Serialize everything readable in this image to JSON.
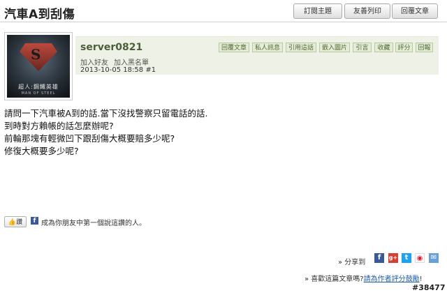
{
  "thread": {
    "title": "汽車A到刮傷"
  },
  "toolbar": {
    "subscribe": "訂閱主題",
    "print": "友善列印",
    "reply": "回覆文章"
  },
  "avatar": {
    "caption": "超人:鋼鐵英雄",
    "subcaption": "MAN OF STEEL"
  },
  "post": {
    "username": "server0821",
    "add_friend": "加入好友",
    "add_blacklist": "加入黑名單",
    "timestamp": "2013-10-05 18:58",
    "floor": "#1",
    "actions": [
      "回覆文章",
      "私人訊息",
      "引用這話",
      "嵌入圖片",
      "引言",
      "收藏",
      "評分",
      "回報"
    ],
    "lines": [
      "請問一下汽車被A到的話.當下沒找警察只留電話的話.",
      "到時對方賴帳的話怎麼辦呢?",
      "前輪那塊有輕微凹下跟刮傷大概要賠多少呢?",
      "修復大概要多少呢?"
    ]
  },
  "like": {
    "button": "讚",
    "text": "成為你朋友中第一個說這讚的人。"
  },
  "share": {
    "label": "» 分享到",
    "icons": [
      "facebook-icon",
      "google-plus-icon",
      "twitter-icon",
      "weibo-icon",
      "email-icon"
    ]
  },
  "rating": {
    "prefix": "» 喜歡這篇文章嗎?",
    "link": "請為作者評分鼓勵",
    "suffix": "!"
  },
  "watermark": "#38477",
  "colors": {
    "accent_green": "#4a5f3a",
    "panel_bg": "#eef2e6",
    "link_blue": "#1f5fa8",
    "facebook": "#3b5998"
  }
}
